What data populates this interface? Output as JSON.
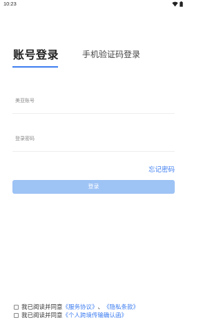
{
  "status_bar": {
    "time": "10:23",
    "icons": [
      "wifi-icon",
      "battery-icon"
    ]
  },
  "tabs": {
    "account_login": "账号登录",
    "sms_login": "手机验证码登录"
  },
  "fields": {
    "username_placeholder": "美亚账号",
    "password_placeholder": "登录密码"
  },
  "forgot_password": "忘记密码",
  "login_button": "登录",
  "agreement": {
    "line1_prefix": "我已阅读并同意",
    "service_agreement": "《服务协议》",
    "separator": "、",
    "privacy_policy": "《隐私条款》",
    "line2_prefix": "我已阅读并同意",
    "cross_border": "《个人跨境传输确认函》"
  },
  "colors": {
    "accent": "#3c7cf0",
    "button_disabled": "#9ec3f5"
  }
}
